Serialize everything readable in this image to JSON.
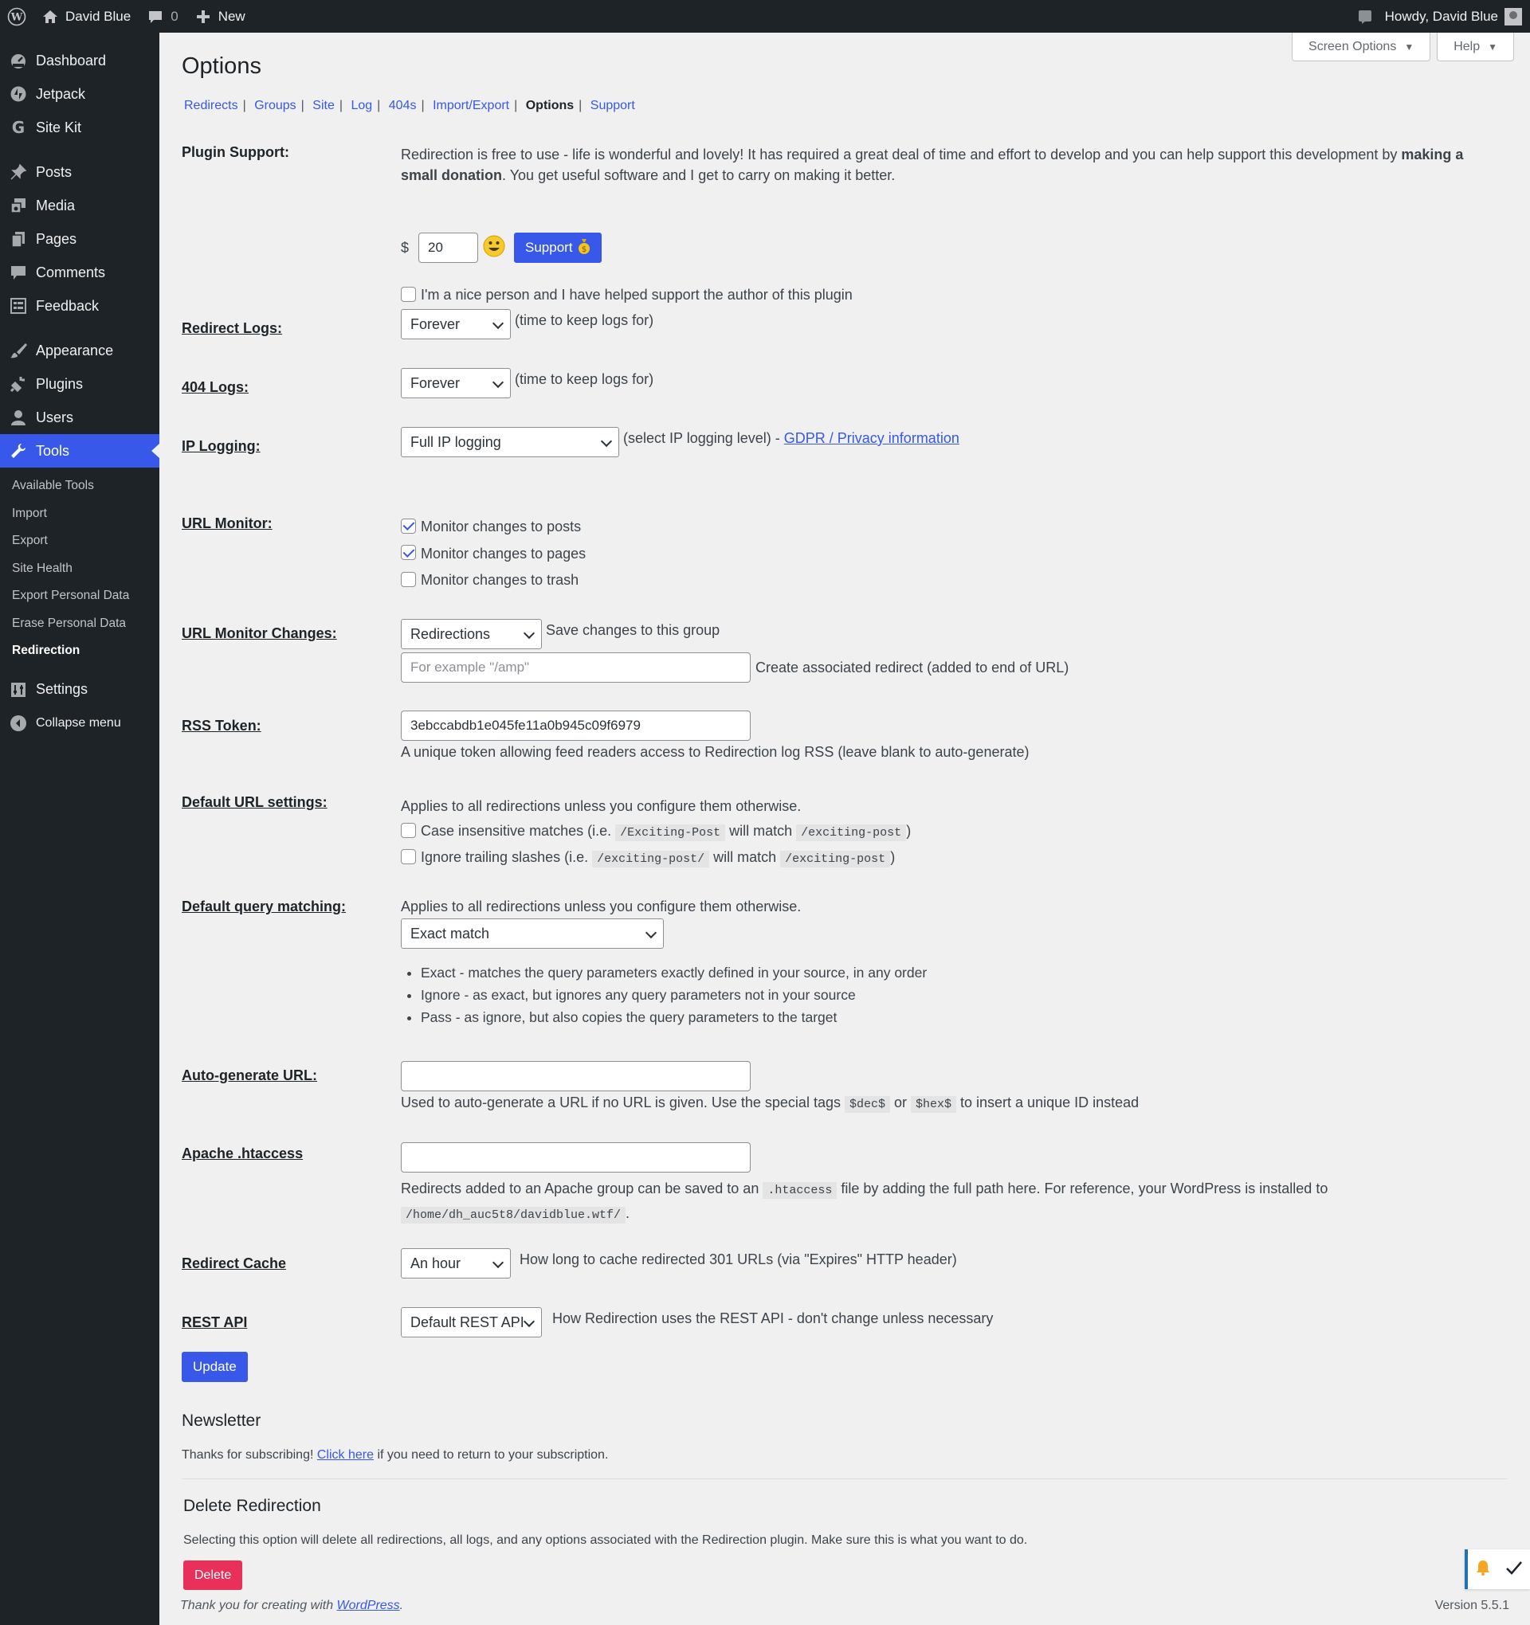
{
  "adminbar": {
    "site_name": "David Blue",
    "comments_count": "0",
    "new_label": "New",
    "howdy": "Howdy, David Blue"
  },
  "sidebar": {
    "items": [
      {
        "label": "Dashboard",
        "icon": "dashboard-icon"
      },
      {
        "label": "Jetpack",
        "icon": "jetpack-icon"
      },
      {
        "label": "Site Kit",
        "icon": "google-icon"
      },
      {
        "label": "Posts",
        "icon": "pin-icon"
      },
      {
        "label": "Media",
        "icon": "media-icon"
      },
      {
        "label": "Pages",
        "icon": "pages-icon"
      },
      {
        "label": "Comments",
        "icon": "comment-icon"
      },
      {
        "label": "Feedback",
        "icon": "feedback-icon"
      },
      {
        "label": "Appearance",
        "icon": "brush-icon"
      },
      {
        "label": "Plugins",
        "icon": "plugin-icon"
      },
      {
        "label": "Users",
        "icon": "user-icon"
      },
      {
        "label": "Tools",
        "icon": "wrench-icon"
      },
      {
        "label": "Settings",
        "icon": "settings-icon"
      },
      {
        "label": "Collapse menu",
        "icon": "collapse-icon"
      }
    ],
    "tools_sub": [
      "Available Tools",
      "Import",
      "Export",
      "Site Health",
      "Export Personal Data",
      "Erase Personal Data",
      "Redirection"
    ]
  },
  "screen_meta": {
    "screen_options": "Screen Options",
    "help": "Help"
  },
  "page": {
    "title": "Options",
    "nav": [
      {
        "label": "Redirects"
      },
      {
        "label": "Groups"
      },
      {
        "label": "Site"
      },
      {
        "label": "Log"
      },
      {
        "label": "404s"
      },
      {
        "label": "Import/Export"
      },
      {
        "label": "Options"
      },
      {
        "label": "Support"
      }
    ]
  },
  "options": {
    "plugin_support": {
      "label": "Plugin Support:",
      "text1": "Redirection is free to use - life is wonderful and lovely! It has required a great deal of time and effort to develop and you can help support this development by ",
      "text_bold": "making a small donation",
      "text2": ". You get useful software and I get to carry on making it better.",
      "currency": "$",
      "amount": "20",
      "support_button": "Support",
      "nice_person": "I'm a nice person and I have helped support the author of this plugin"
    },
    "redirect_logs": {
      "label": "Redirect Logs:",
      "value": "Forever",
      "help": "(time to keep logs for)"
    },
    "logs_404": {
      "label": "404 Logs:",
      "value": "Forever",
      "help": "(time to keep logs for)"
    },
    "ip_logging": {
      "label": "IP Logging:",
      "value": "Full IP logging",
      "help": "(select IP logging level) - ",
      "link": "GDPR / Privacy information"
    },
    "url_monitor": {
      "label": "URL Monitor:",
      "items": [
        {
          "label": "Monitor changes to posts",
          "checked": true
        },
        {
          "label": "Monitor changes to pages",
          "checked": true
        },
        {
          "label": "Monitor changes to trash",
          "checked": false
        }
      ]
    },
    "url_monitor_changes": {
      "label": "URL Monitor Changes:",
      "group_value": "Redirections",
      "group_help": "Save changes to this group",
      "placeholder": "For example \"/amp\"",
      "assoc_help": "Create associated redirect (added to end of URL)"
    },
    "rss_token": {
      "label": "RSS Token:",
      "value": "3ebccabdb1e045fe11a0b945c09f6979",
      "help": "A unique token allowing feed readers access to Redirection log RSS (leave blank to auto-generate)"
    },
    "default_url": {
      "label": "Default URL settings:",
      "intro": "Applies to all redirections unless you configure them otherwise.",
      "case_text": "Case insensitive matches (i.e. ",
      "case_code1": "/Exciting-Post",
      "case_mid": " will match ",
      "case_code2": "/exciting-post",
      "close": ")",
      "slash_text": "Ignore trailing slashes (i.e. ",
      "slash_code1": "/exciting-post/",
      "slash_mid": " will match ",
      "slash_code2": "/exciting-post"
    },
    "default_query": {
      "label": "Default query matching:",
      "intro": "Applies to all redirections unless you configure them otherwise.",
      "value": "Exact match",
      "bullets": [
        "Exact - matches the query parameters exactly defined in your source, in any order",
        "Ignore - as exact, but ignores any query parameters not in your source",
        "Pass - as ignore, but also copies the query parameters to the target"
      ]
    },
    "auto_url": {
      "label": "Auto-generate URL:",
      "help1": "Used to auto-generate a URL if no URL is given. Use the special tags ",
      "code1": "$dec$",
      "or": " or ",
      "code2": "$hex$",
      "help2": " to insert a unique ID instead"
    },
    "htaccess": {
      "label": "Apache .htaccess",
      "help1": "Redirects added to an Apache group can be saved to an ",
      "code1": ".htaccess",
      "help2": " file by adding the full path here. For reference, your WordPress is installed to ",
      "code2": "/home/dh_auc5t8/davidblue.wtf/",
      "period": "."
    },
    "redirect_cache": {
      "label": "Redirect Cache",
      "value": "An hour",
      "help": "How long to cache redirected 301 URLs (via \"Expires\" HTTP header)"
    },
    "rest_api": {
      "label": "REST API",
      "value": "Default REST API",
      "help": "How Redirection uses the REST API - don't change unless necessary"
    },
    "update_button": "Update"
  },
  "newsletter": {
    "title": "Newsletter",
    "text1": "Thanks for subscribing! ",
    "link": "Click here",
    "text2": " if you need to return to your subscription."
  },
  "delete": {
    "title": "Delete Redirection",
    "text": "Selecting this option will delete all redirections, all logs, and any options associated with the Redirection plugin. Make sure this is what you want to do.",
    "button": "Delete"
  },
  "footer": {
    "text": "Thank you for creating with ",
    "link": "WordPress",
    "period": ".",
    "version": "Version 5.5.1"
  },
  "colors": {
    "accent": "#3858e9",
    "delete": "#e8305a",
    "admin_dark": "#1d2327"
  }
}
